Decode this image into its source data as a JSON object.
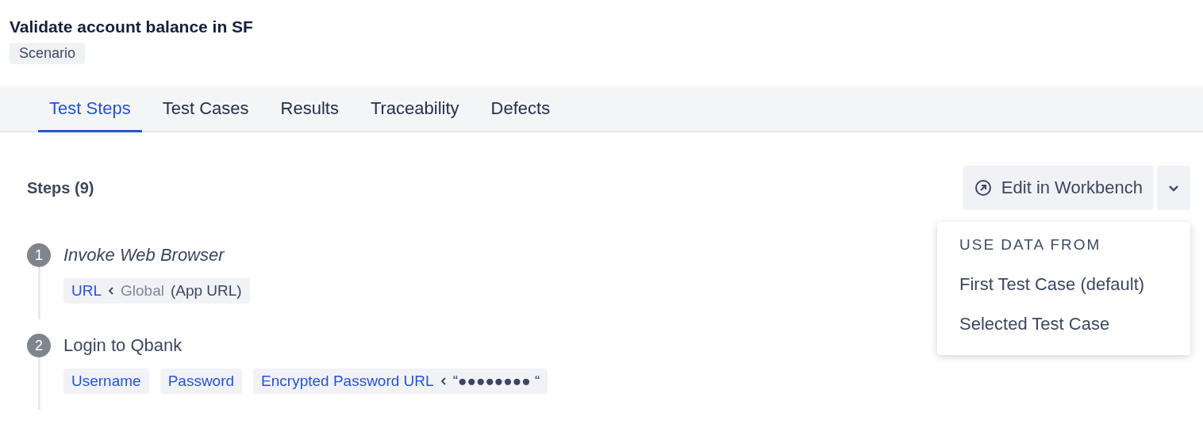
{
  "header": {
    "title": "Validate account balance in SF",
    "badge": "Scenario"
  },
  "tabs": [
    {
      "label": "Test Steps",
      "selected": true
    },
    {
      "label": "Test Cases",
      "selected": false
    },
    {
      "label": "Results",
      "selected": false
    },
    {
      "label": "Traceability",
      "selected": false
    },
    {
      "label": "Defects",
      "selected": false
    }
  ],
  "steps_heading": "Steps (9)",
  "edit_button": {
    "label": "Edit in Workbench"
  },
  "dropdown": {
    "expanded": true,
    "heading": "USE DATA FROM",
    "items": [
      "First Test Case (default)",
      "Selected Test Case"
    ]
  },
  "steps": [
    {
      "number": "1",
      "title": "Invoke Web Browser",
      "italic": true,
      "params": [
        {
          "name": "URL",
          "source": "Global",
          "value": "(App URL)"
        }
      ]
    },
    {
      "number": "2",
      "title": "Login to Qbank",
      "italic": false,
      "params": [
        {
          "name": "Username"
        },
        {
          "name": "Password"
        },
        {
          "name": "Encrypted Password URL",
          "value": "“●●●●●●●● “"
        }
      ]
    }
  ]
}
